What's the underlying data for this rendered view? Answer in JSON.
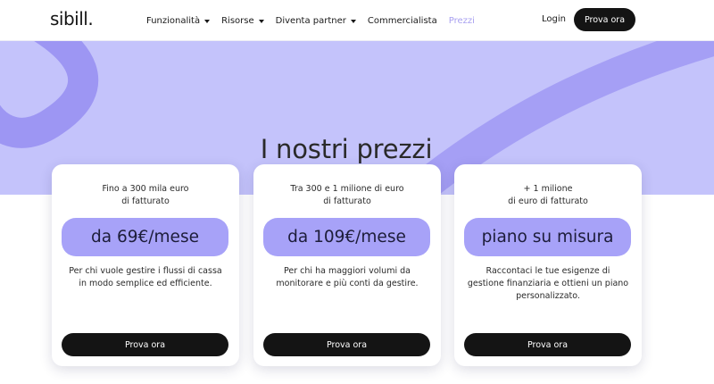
{
  "header": {
    "logo": "sibill.",
    "nav": [
      {
        "label": "Funzionalità",
        "has_dropdown": true,
        "active": false
      },
      {
        "label": "Risorse",
        "has_dropdown": true,
        "active": false
      },
      {
        "label": "Diventa partner",
        "has_dropdown": true,
        "active": false
      },
      {
        "label": "Commercialista",
        "has_dropdown": false,
        "active": false
      },
      {
        "label": "Prezzi",
        "has_dropdown": false,
        "active": true
      }
    ],
    "login": "Login",
    "cta": "Prova ora"
  },
  "hero": {
    "title": "I nostri prezzi"
  },
  "plans": [
    {
      "head_line1": "Fino a 300 mila euro",
      "head_line2": "di fatturato",
      "price": "da 69€/mese",
      "desc_line1": "Per chi vuole gestire i flussi di cassa",
      "desc_line2": "in modo semplice ed efficiente.",
      "desc_line3": "",
      "button": "Prova ora"
    },
    {
      "head_line1": "Tra 300 e 1 milione di euro",
      "head_line2": "di fatturato",
      "price": "da 109€/mese",
      "desc_line1": "Per chi ha maggiori volumi da",
      "desc_line2": "monitorare e più conti da gestire.",
      "desc_line3": "",
      "button": "Prova ora"
    },
    {
      "head_line1": "+ 1 milione",
      "head_line2": "di euro di fatturato",
      "price": "piano su misura",
      "desc_line1": "Raccontaci le tue esigenze di",
      "desc_line2": "gestione finanziaria e ottieni un piano",
      "desc_line3": "personalizzato.",
      "button": "Prova ora"
    }
  ],
  "colors": {
    "hero_bg": "#c4c3fb",
    "hero_stroke": "#9d96f3",
    "pill": "#a7a2f8",
    "button": "#141414",
    "active_nav": "#a8a0f0"
  }
}
